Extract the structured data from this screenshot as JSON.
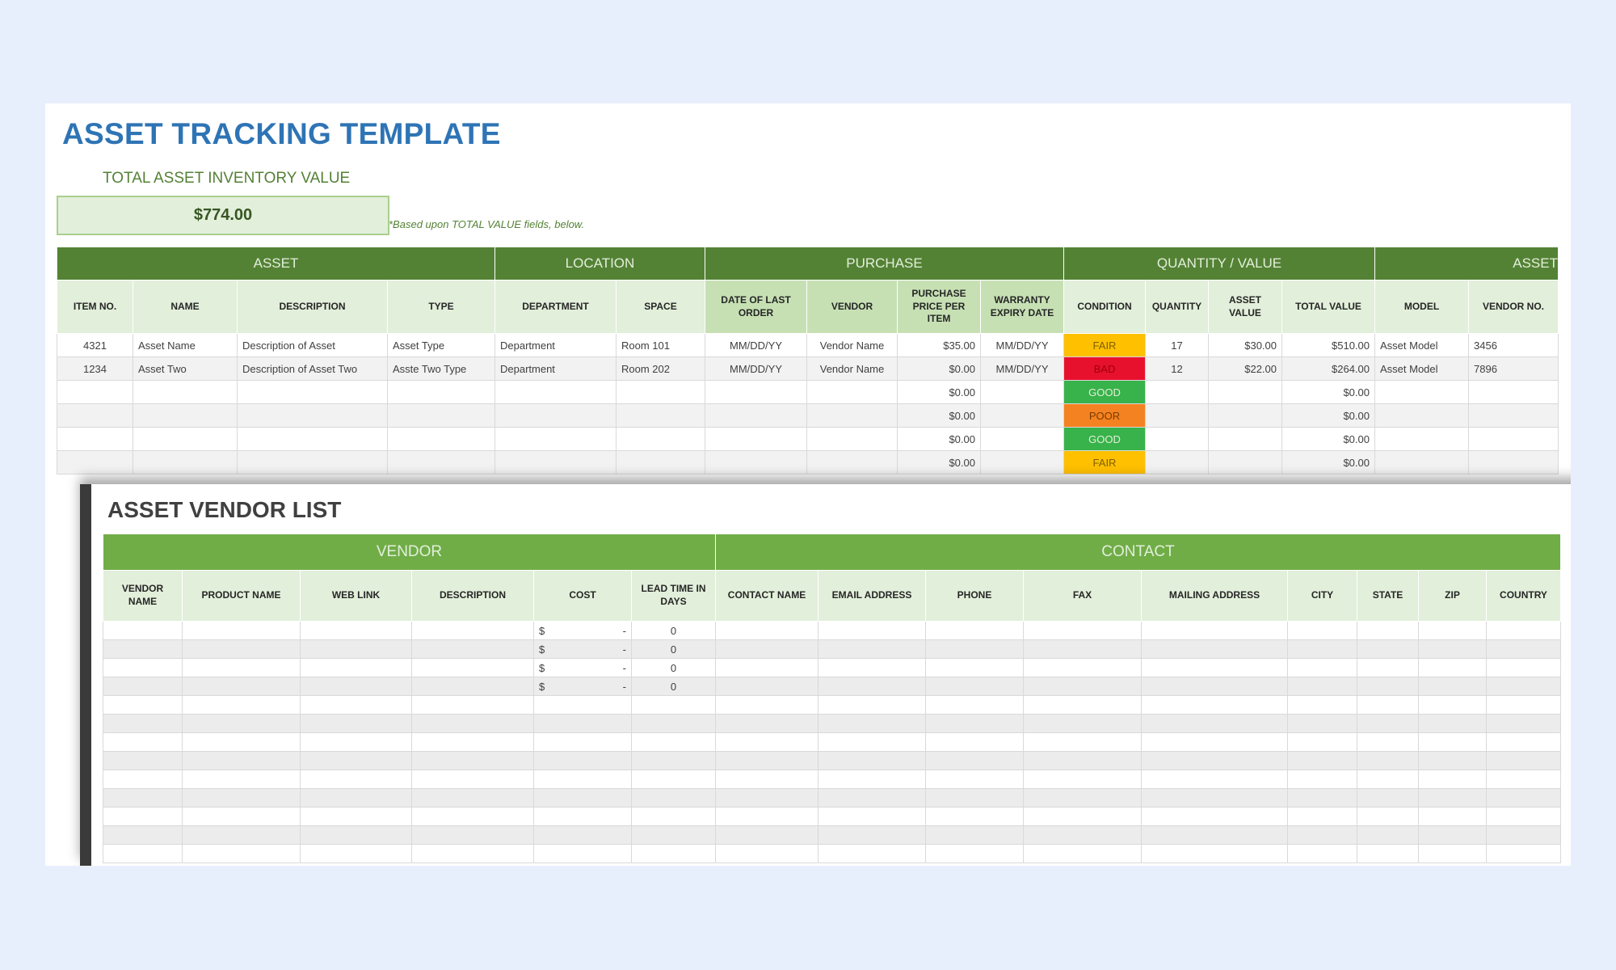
{
  "page": {
    "title": "ASSET TRACKING TEMPLATE",
    "inventory_label": "TOTAL ASSET INVENTORY VALUE",
    "inventory_value": "$774.00",
    "inventory_note": "*Based upon TOTAL VALUE fields, below."
  },
  "asset_table": {
    "groups": [
      "ASSET",
      "LOCATION",
      "PURCHASE",
      "QUANTITY / VALUE",
      "ASSET"
    ],
    "headers": [
      "ITEM NO.",
      "NAME",
      "DESCRIPTION",
      "TYPE",
      "DEPARTMENT",
      "SPACE",
      "DATE OF LAST ORDER",
      "VENDOR",
      "PURCHASE PRICE PER ITEM",
      "WARRANTY EXPIRY DATE",
      "CONDITION",
      "QUANTITY",
      "ASSET VALUE",
      "TOTAL VALUE",
      "MODEL",
      "VENDOR NO."
    ],
    "rows": [
      [
        "4321",
        "Asset Name",
        "Description of Asset",
        "Asset Type",
        "Department",
        "Room 101",
        "MM/DD/YY",
        "Vendor Name",
        "$35.00",
        "MM/DD/YY",
        "FAIR",
        "17",
        "$30.00",
        "$510.00",
        "Asset Model",
        "3456"
      ],
      [
        "1234",
        "Asset Two",
        "Description of Asset Two",
        "Asste Two Type",
        "Department",
        "Room 202",
        "MM/DD/YY",
        "Vendor Name",
        "$0.00",
        "MM/DD/YY",
        "BAD",
        "12",
        "$22.00",
        "$264.00",
        "Asset Model",
        "7896"
      ],
      [
        "",
        "",
        "",
        "",
        "",
        "",
        "",
        "",
        "$0.00",
        "",
        "GOOD",
        "",
        "",
        "$0.00",
        "",
        ""
      ],
      [
        "",
        "",
        "",
        "",
        "",
        "",
        "",
        "",
        "$0.00",
        "",
        "POOR",
        "",
        "",
        "$0.00",
        "",
        ""
      ],
      [
        "",
        "",
        "",
        "",
        "",
        "",
        "",
        "",
        "$0.00",
        "",
        "GOOD",
        "",
        "",
        "$0.00",
        "",
        ""
      ],
      [
        "",
        "",
        "",
        "",
        "",
        "",
        "",
        "",
        "$0.00",
        "",
        "FAIR",
        "",
        "",
        "$0.00",
        "",
        ""
      ]
    ],
    "condition_colors": {
      "FAIR": "#ffc000",
      "BAD": "#e8112d",
      "GOOD": "#38b24a",
      "POOR": "#f58220"
    }
  },
  "vendor_list": {
    "title": "ASSET VENDOR LIST",
    "groups": [
      "VENDOR",
      "CONTACT"
    ],
    "headers": [
      "VENDOR NAME",
      "PRODUCT NAME",
      "WEB LINK",
      "DESCRIPTION",
      "COST",
      "LEAD TIME IN DAYS",
      "CONTACT NAME",
      "EMAIL ADDRESS",
      "PHONE",
      "FAX",
      "MAILING ADDRESS",
      "CITY",
      "STATE",
      "ZIP",
      "COUNTRY"
    ],
    "rows": [
      {
        "cost_symbol": "$",
        "cost_value": "-",
        "lead_time": "0"
      },
      {
        "cost_symbol": "$",
        "cost_value": "-",
        "lead_time": "0"
      },
      {
        "cost_symbol": "$",
        "cost_value": "-",
        "lead_time": "0"
      },
      {
        "cost_symbol": "$",
        "cost_value": "-",
        "lead_time": "0"
      },
      {},
      {},
      {},
      {},
      {},
      {},
      {},
      {},
      {}
    ]
  },
  "colors": {
    "title_blue": "#2e74b5",
    "group_header_green": "#548235",
    "vendor_group_green": "#70ad47",
    "header_light_green": "#e2efda",
    "background": "#e8effc"
  }
}
